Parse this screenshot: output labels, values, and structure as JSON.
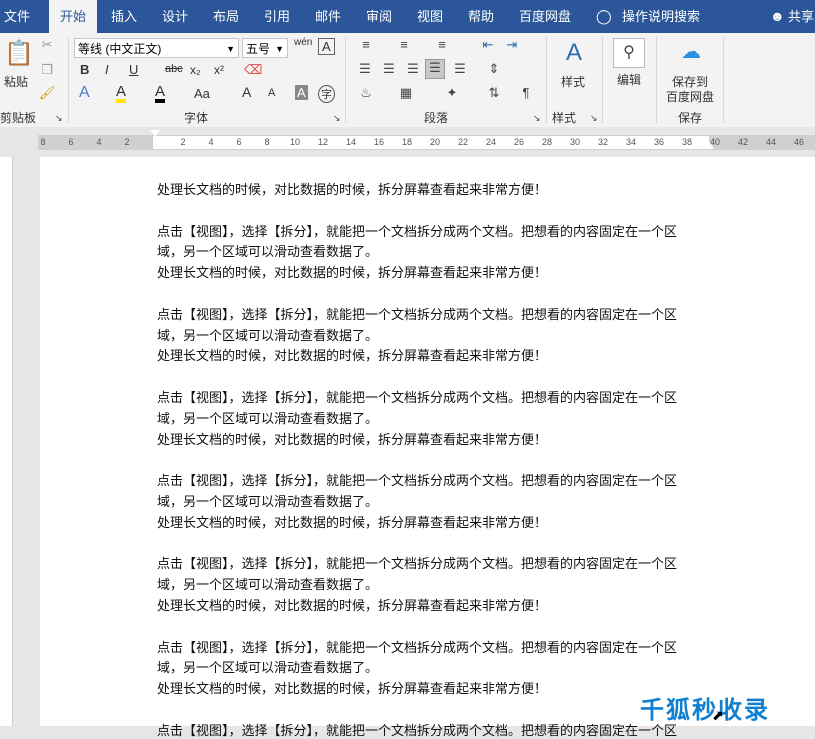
{
  "tabs": {
    "file": "文件",
    "home": "开始",
    "insert": "插入",
    "design": "设计",
    "layout": "布局",
    "references": "引用",
    "mailings": "邮件",
    "review": "审阅",
    "view": "视图",
    "help": "帮助",
    "baidu": "百度网盘",
    "tell_me": "操作说明搜索",
    "share": "共享"
  },
  "ribbon": {
    "clipboard": {
      "paste": "粘贴",
      "label": "剪贴板"
    },
    "font": {
      "name": "等线 (中文正文)",
      "size": "五号",
      "label": "字体",
      "bold": "B",
      "italic": "I",
      "underline": "U",
      "strike": "abc",
      "sub": "x₂",
      "sup": "x²",
      "case": "Aa",
      "grow": "A",
      "shrink": "A",
      "wen": "wén",
      "border_a": "A",
      "font_color_a": "A",
      "highlight_a": "A",
      "effects_a": "A",
      "shade_a": "A",
      "circle_char": "字"
    },
    "paragraph": {
      "label": "段落"
    },
    "styles": {
      "button": "样式",
      "label": "样式"
    },
    "editing": {
      "button": "编辑"
    },
    "save": {
      "button_line1": "保存到",
      "button_line2": "百度网盘",
      "label": "保存"
    }
  },
  "ruler": {
    "ticks": [
      "8",
      "6",
      "4",
      "2",
      "",
      "2",
      "4",
      "6",
      "8",
      "10",
      "12",
      "14",
      "16",
      "18",
      "20",
      "22",
      "24",
      "26",
      "28",
      "30",
      "32",
      "34",
      "36",
      "38",
      "40",
      "42",
      "44",
      "46",
      "48"
    ]
  },
  "document": {
    "lines": [
      "处理长文档的时候，对比数据的时候，拆分屏幕查看起来非常方便！",
      "",
      "点击【视图】，选择【拆分】，就能把一个文档拆分成两个文档。把想看的内容固定在一个区",
      "域，另一个区域可以滑动查看数据了。",
      "处理长文档的时候，对比数据的时候，拆分屏幕查看起来非常方便！",
      "",
      "点击【视图】，选择【拆分】，就能把一个文档拆分成两个文档。把想看的内容固定在一个区",
      "域，另一个区域可以滑动查看数据了。",
      "处理长文档的时候，对比数据的时候，拆分屏幕查看起来非常方便！",
      "",
      "点击【视图】，选择【拆分】，就能把一个文档拆分成两个文档。把想看的内容固定在一个区",
      "域，另一个区域可以滑动查看数据了。",
      "处理长文档的时候，对比数据的时候，拆分屏幕查看起来非常方便！",
      "",
      "点击【视图】，选择【拆分】，就能把一个文档拆分成两个文档。把想看的内容固定在一个区",
      "域，另一个区域可以滑动查看数据了。",
      "处理长文档的时候，对比数据的时候，拆分屏幕查看起来非常方便！",
      "",
      "点击【视图】，选择【拆分】，就能把一个文档拆分成两个文档。把想看的内容固定在一个区",
      "域，另一个区域可以滑动查看数据了。",
      "处理长文档的时候，对比数据的时候，拆分屏幕查看起来非常方便！",
      "",
      "点击【视图】，选择【拆分】，就能把一个文档拆分成两个文档。把想看的内容固定在一个区",
      "域，另一个区域可以滑动查看数据了。",
      "处理长文档的时候，对比数据的时候，拆分屏幕查看起来非常方便！",
      "",
      "点击【视图】，选择【拆分】，就能把一个文档拆分成两个文档。把想看的内容固定在一个区"
    ]
  },
  "watermark": "千狐秒收录",
  "colors": {
    "accent": "#2b579a",
    "watermark": "#0f7fd1"
  }
}
